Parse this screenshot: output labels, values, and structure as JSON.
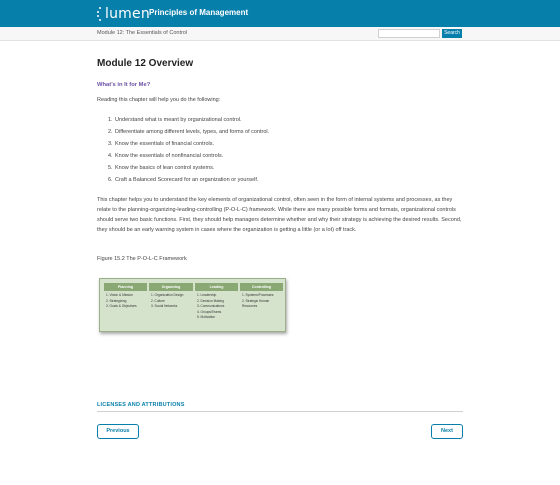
{
  "header": {
    "logo_text": "lumen",
    "book_title": "Principles of Management"
  },
  "subheader": {
    "breadcrumb": "Module 12: The Essentials of Control",
    "search_placeholder": "",
    "search_button": "Search"
  },
  "main": {
    "title": "Module 12 Overview",
    "section_heading": "What’s in It for Me?",
    "intro": "Reading this chapter will help you do the following:",
    "objectives": [
      {
        "num": "1.",
        "text": "Understand what is meant by organizational control."
      },
      {
        "num": "2.",
        "text": "Differentiate among different levels, types, and forms of control."
      },
      {
        "num": "3.",
        "text": "Know the essentials of financial controls."
      },
      {
        "num": "4.",
        "text": "Know the essentials of nonfinancial controls."
      },
      {
        "num": "5.",
        "text": "Know the basics of lean control systems."
      },
      {
        "num": "6.",
        "text": "Craft a Balanced Scorecard for an organization or yourself."
      }
    ],
    "paragraph": "This chapter helps you to understand the key elements of organizational control, often seen in the form of internal systems and processes, as they relate to the planning-organizing-leading-controlling (P-O-L-C) framework. While there are many possible forms and formats, organizational controls should serve two basic functions. First, they should help managers determine whether and why their strategy is achieving the desired results. Second, they should be an early warning system in cases where the organization is getting a little (or a lot) off track.",
    "figure_caption": "Figure 15.2 The P-O-L-C Framework",
    "figure": {
      "columns": [
        {
          "head": "Planning",
          "items": [
            "1. Vision & Mission",
            "2. Strategizing",
            "3. Goals & Objectives"
          ]
        },
        {
          "head": "Organizing",
          "items": [
            "1. Organization Design",
            "2. Culture",
            "3. Social Networks"
          ]
        },
        {
          "head": "Leading",
          "items": [
            "1. Leadership",
            "2. Decision Making",
            "3. Communications",
            "4. Groups/Teams",
            "5. Motivation"
          ]
        },
        {
          "head": "Controlling",
          "items": [
            "1. Systems/Processes",
            "2. Strategic Human",
            "   Resources"
          ]
        }
      ]
    }
  },
  "footer": {
    "licenses": "LICENSES AND ATTRIBUTIONS",
    "previous": "Previous",
    "next": "Next"
  }
}
